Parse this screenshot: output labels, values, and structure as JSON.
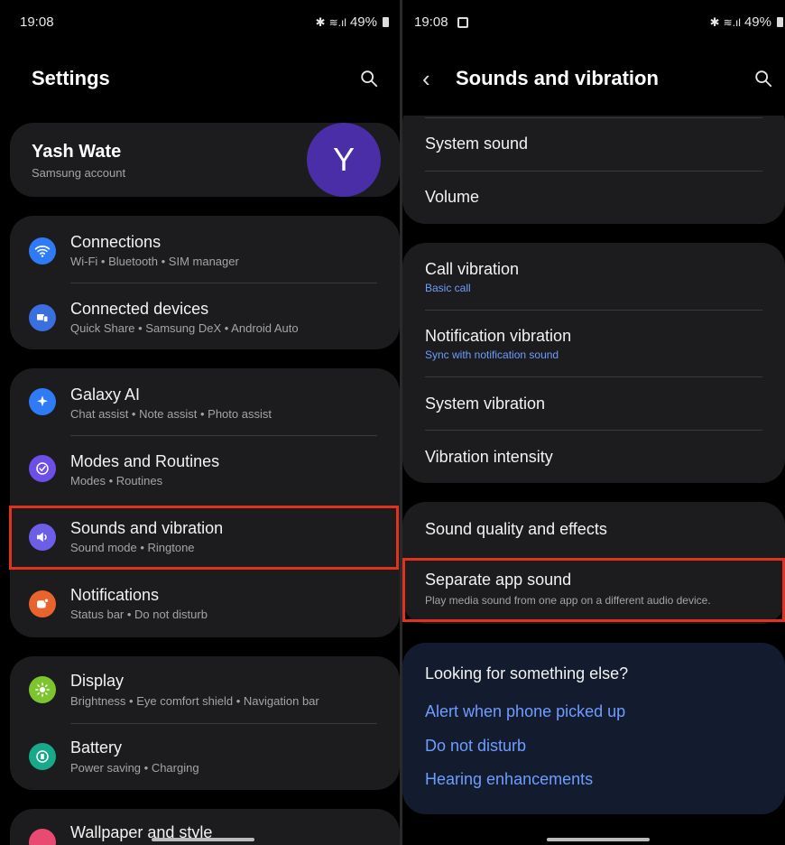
{
  "left": {
    "status": {
      "time": "19:08",
      "battery": "49%"
    },
    "title": "Settings",
    "account": {
      "name": "Yash Wate",
      "sub": "Samsung account",
      "avatar_letter": "Y"
    },
    "items": [
      {
        "title": "Connections",
        "sub": "Wi-Fi  •  Bluetooth  •  SIM manager",
        "icon": "wifi-icon",
        "color": "#2f7bf6"
      },
      {
        "title": "Connected devices",
        "sub": "Quick Share  •  Samsung DeX  •  Android Auto",
        "icon": "devices-icon",
        "color": "#3a6fe0"
      },
      {
        "title": "Galaxy AI",
        "sub": "Chat assist  •  Note assist  •  Photo assist",
        "icon": "sparkle-icon",
        "color": "#2f7bf6"
      },
      {
        "title": "Modes and Routines",
        "sub": "Modes  •  Routines",
        "icon": "check-circle-icon",
        "color": "#6c4fe6"
      },
      {
        "title": "Sounds and vibration",
        "sub": "Sound mode  •  Ringtone",
        "icon": "speaker-icon",
        "color": "#6d5ee8"
      },
      {
        "title": "Notifications",
        "sub": "Status bar  •  Do not disturb",
        "icon": "bell-badge-icon",
        "color": "#e8642c"
      },
      {
        "title": "Display",
        "sub": "Brightness  •  Eye comfort shield  •  Navigation bar",
        "icon": "sun-icon",
        "color": "#7cc52e"
      },
      {
        "title": "Battery",
        "sub": "Power saving  •  Charging",
        "icon": "battery-icon",
        "color": "#18a88a"
      },
      {
        "title": "Wallpaper and style",
        "icon": "palette-icon",
        "color": "#e84a72"
      }
    ]
  },
  "right": {
    "status": {
      "time": "19:08",
      "battery": "49%"
    },
    "title": "Sounds and vibration",
    "group1": [
      {
        "title": "System sound"
      },
      {
        "title": "Volume"
      }
    ],
    "group2": [
      {
        "title": "Call vibration",
        "sub": "Basic call"
      },
      {
        "title": "Notification vibration",
        "sub": "Sync with notification sound"
      },
      {
        "title": "System vibration"
      },
      {
        "title": "Vibration intensity"
      }
    ],
    "group3": [
      {
        "title": "Sound quality and effects"
      },
      {
        "title": "Separate app sound",
        "sub": "Play media sound from one app on a different audio device."
      }
    ],
    "looking": {
      "heading": "Looking for something else?",
      "links": [
        "Alert when phone picked up",
        "Do not disturb",
        "Hearing enhancements"
      ]
    }
  }
}
